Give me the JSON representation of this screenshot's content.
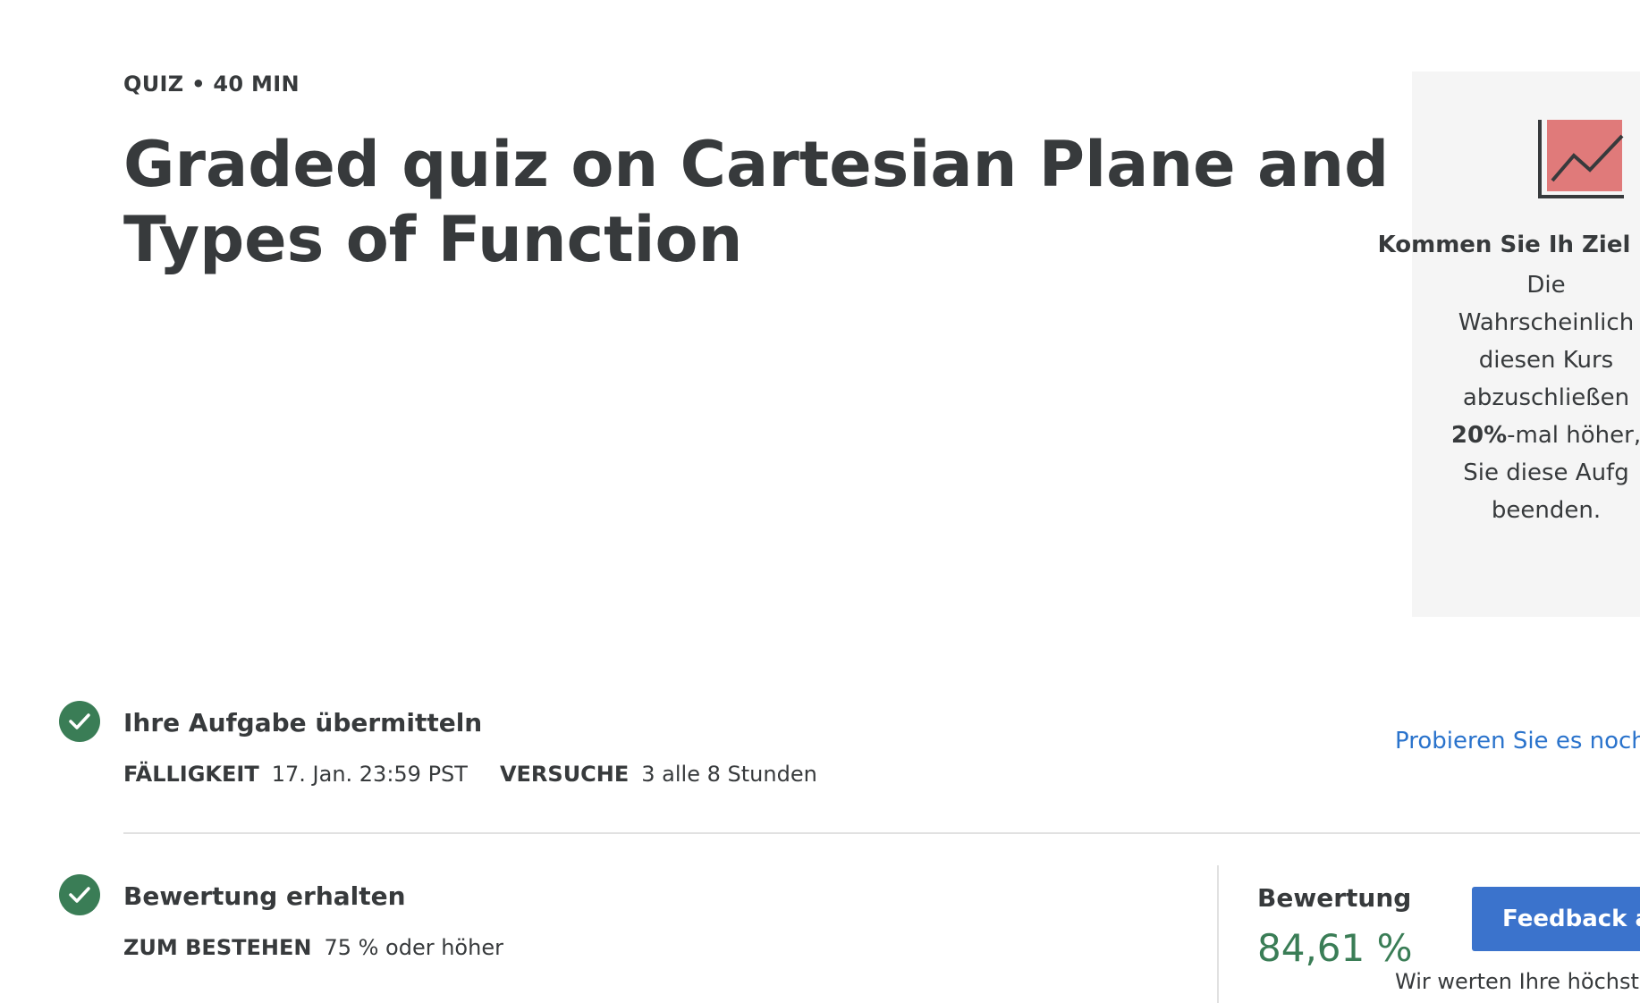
{
  "header": {
    "meta": "QUIZ • 40 MIN",
    "title": "Graded quiz on Cartesian Plane and Types of Function"
  },
  "info_panel": {
    "icon": "line-chart-icon",
    "heading": "Kommen Sie Ih Ziel näher",
    "body_lines": [
      "Die",
      "Wahrscheinlich",
      "diesen Kurs",
      "abzuschließen",
      "-mal höher,",
      "Sie diese Aufg",
      "beenden."
    ],
    "highlight": "20%",
    "accent_color": "#e07a7a"
  },
  "submit_step": {
    "title": "Ihre Aufgabe übermitteln",
    "due_label": "FÄLLIGKEIT",
    "due_value": "17. Jan. 23:59 PST",
    "attempts_label": "VERSUCHE",
    "attempts_value": "3 alle 8 Stunden",
    "retry_link": "Probieren Sie es noch"
  },
  "grade_step": {
    "title": "Bewertung erhalten",
    "pass_label": "ZUM BESTEHEN",
    "pass_value": "75 % oder höher",
    "grade_label": "Bewertung",
    "grade_value": "84,61 %",
    "feedback_button": "Feedback an",
    "note": "Wir werten Ihre höchste"
  },
  "colors": {
    "success_green": "#3a7d56",
    "link_blue": "#2a73cc",
    "button_blue": "#3b73cc",
    "text": "#373a3c"
  }
}
